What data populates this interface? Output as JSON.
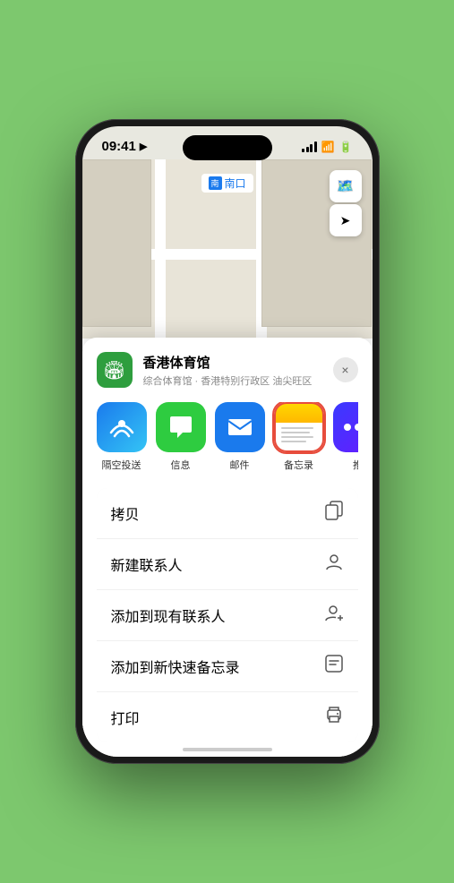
{
  "status": {
    "time": "09:41",
    "location_arrow": "▶"
  },
  "map": {
    "label_text": "南口",
    "label_prefix": "南",
    "stadium_name": "香港体育馆",
    "stadium_emoji": "🏟️"
  },
  "location_card": {
    "name": "香港体育馆",
    "subtitle": "综合体育馆 · 香港特别行政区 油尖旺区",
    "close_symbol": "×"
  },
  "share_items": [
    {
      "id": "airdrop",
      "label": "隔空投送",
      "emoji": "📡"
    },
    {
      "id": "message",
      "label": "信息",
      "emoji": "💬"
    },
    {
      "id": "mail",
      "label": "邮件",
      "emoji": "✉️"
    },
    {
      "id": "notes",
      "label": "备忘录",
      "emoji": ""
    },
    {
      "id": "more",
      "label": "推",
      "emoji": "⋯"
    }
  ],
  "actions": [
    {
      "id": "copy",
      "label": "拷贝",
      "icon": "⧉"
    },
    {
      "id": "new-contact",
      "label": "新建联系人",
      "icon": "👤"
    },
    {
      "id": "add-contact",
      "label": "添加到现有联系人",
      "icon": "👤"
    },
    {
      "id": "add-notes",
      "label": "添加到新快速备忘录",
      "icon": "📋"
    },
    {
      "id": "print",
      "label": "打印",
      "icon": "🖨"
    }
  ]
}
